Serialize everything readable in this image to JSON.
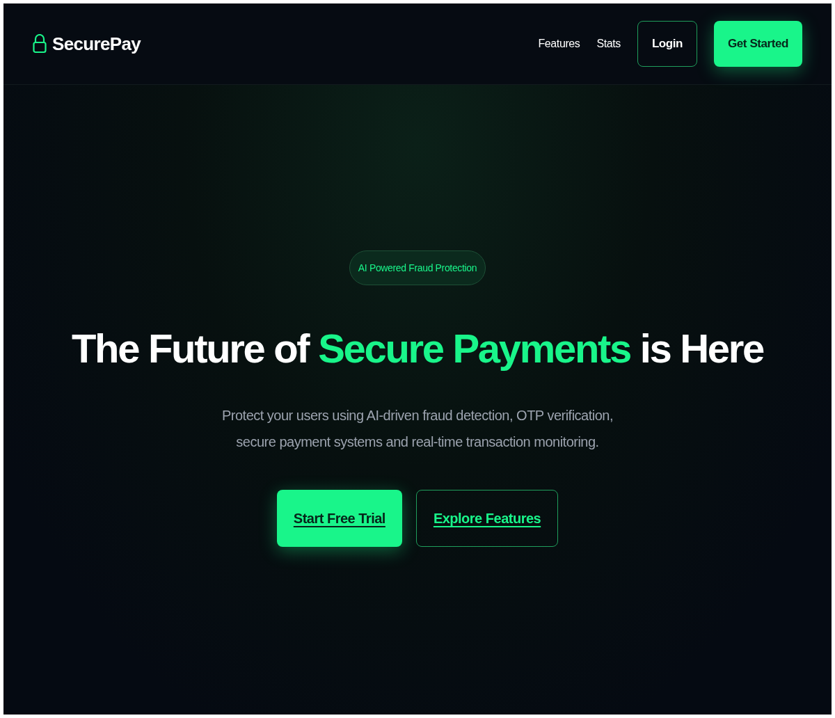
{
  "brand": {
    "name": "SecurePay"
  },
  "nav": [
    {
      "label": "Features",
      "kind": "link"
    },
    {
      "label": "Stats",
      "kind": "link"
    },
    {
      "label": "Login",
      "kind": "outline"
    },
    {
      "label": "Get Started",
      "kind": "solid"
    }
  ],
  "hero": {
    "badge": "AI Powered Fraud Protection",
    "headline": [
      {
        "text": "The Future of ",
        "highlight": false
      },
      {
        "text": "Secure Payments",
        "highlight": true
      },
      {
        "text": " is Here",
        "highlight": false
      }
    ],
    "subtitle": "Protect your users using AI-driven fraud detection, OTP verification, secure payment systems and real-time transaction monitoring.",
    "buttons": [
      {
        "label": "Start Free Trial",
        "kind": "solid"
      },
      {
        "label": "Explore Features",
        "kind": "outline"
      }
    ]
  }
}
